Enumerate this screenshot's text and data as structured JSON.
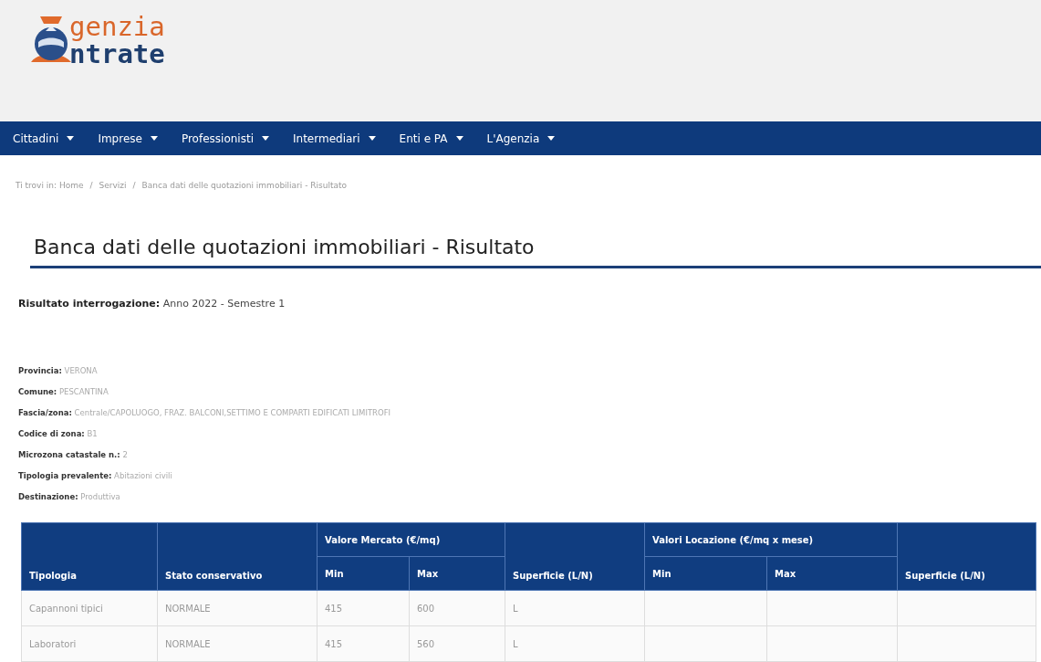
{
  "logo": {
    "line_1": "genzia",
    "line_2": "ntrate"
  },
  "nav": [
    {
      "label": "Cittadini"
    },
    {
      "label": "Imprese"
    },
    {
      "label": "Professionisti"
    },
    {
      "label": "Intermediari"
    },
    {
      "label": "Enti e PA"
    },
    {
      "label": "L'Agenzia"
    }
  ],
  "breadcrumb_separator": "/",
  "breadcrumb": [
    {
      "label": "Ti trovi in: Home"
    },
    {
      "label": "Servizi"
    },
    {
      "label": "Banca dati delle quotazioni immobiliari - Risultato"
    }
  ],
  "title": "Banca dati delle quotazioni immobiliari - Risultato",
  "result": {
    "label": "Risultato interrogazione:",
    "value": "Anno 2022 - Semestre 1"
  },
  "details": [
    {
      "label": "Provincia:",
      "value": "VERONA"
    },
    {
      "label": "Comune:",
      "value": "PESCANTINA"
    },
    {
      "label": "Fascia/zona:",
      "value": "Centrale/CAPOLUOGO, FRAZ. BALCONI,SETTIMO E COMPARTI EDIFICATI LIMITROFI"
    },
    {
      "label": "Codice di zona:",
      "value": "B1"
    },
    {
      "label": "Microzona catastale n.:",
      "value": "2"
    },
    {
      "label": "Tipologia prevalente:",
      "value": "Abitazioni civili"
    },
    {
      "label": "Destinazione:",
      "value": "Produttiva"
    }
  ],
  "table": {
    "groups": [
      {
        "label": "Valore Mercato (€/mq)"
      },
      {
        "label": "Valori Locazione (€/mq x mese)"
      }
    ],
    "columns": [
      "Tipologia",
      "Stato conservativo",
      "Min",
      "Max",
      "Superficie (L/N)",
      "Min",
      "Max",
      "Superficie (L/N)"
    ],
    "rows": [
      [
        "Capannoni tipici",
        "NORMALE",
        "415",
        "600",
        "L",
        "",
        "",
        ""
      ],
      [
        "Laboratori",
        "NORMALE",
        "415",
        "560",
        "L",
        "",
        "",
        ""
      ]
    ]
  }
}
